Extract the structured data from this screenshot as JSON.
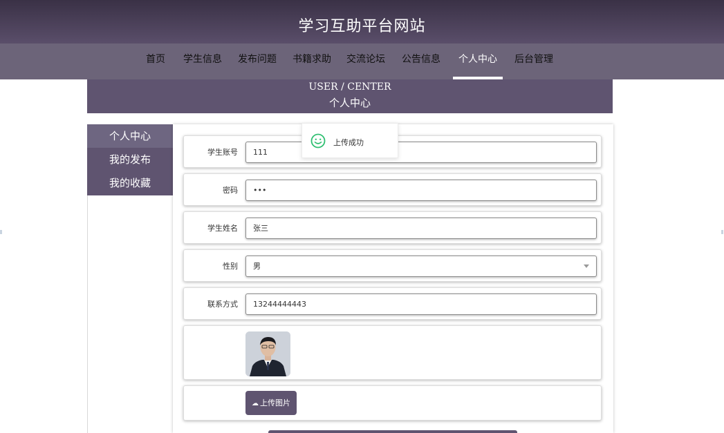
{
  "site": {
    "title": "学习互助平台网站"
  },
  "nav": {
    "items": [
      "首页",
      "学生信息",
      "发布问题",
      "书籍求助",
      "交流论坛",
      "公告信息",
      "个人中心",
      "后台管理"
    ],
    "active": "个人中心"
  },
  "banner": {
    "en": "USER / CENTER",
    "cn": "个人中心"
  },
  "side_menu": {
    "items": [
      "个人中心",
      "我的发布",
      "我的收藏"
    ],
    "active": "个人中心"
  },
  "form": {
    "account": {
      "label": "学生账号",
      "value": "111"
    },
    "password": {
      "label": "密码",
      "value": "•••"
    },
    "name": {
      "label": "学生姓名",
      "value": "张三"
    },
    "gender": {
      "label": "性别",
      "value": "男"
    },
    "phone": {
      "label": "联系方式",
      "value": "13244444443"
    },
    "upload_label": "上传图片"
  },
  "toast": {
    "text": "上传成功"
  },
  "colors": {
    "primary": "#5f5470",
    "header_dark": "#3a3146",
    "nav": "#6c6479",
    "toast_icon": "#2fbf71"
  }
}
